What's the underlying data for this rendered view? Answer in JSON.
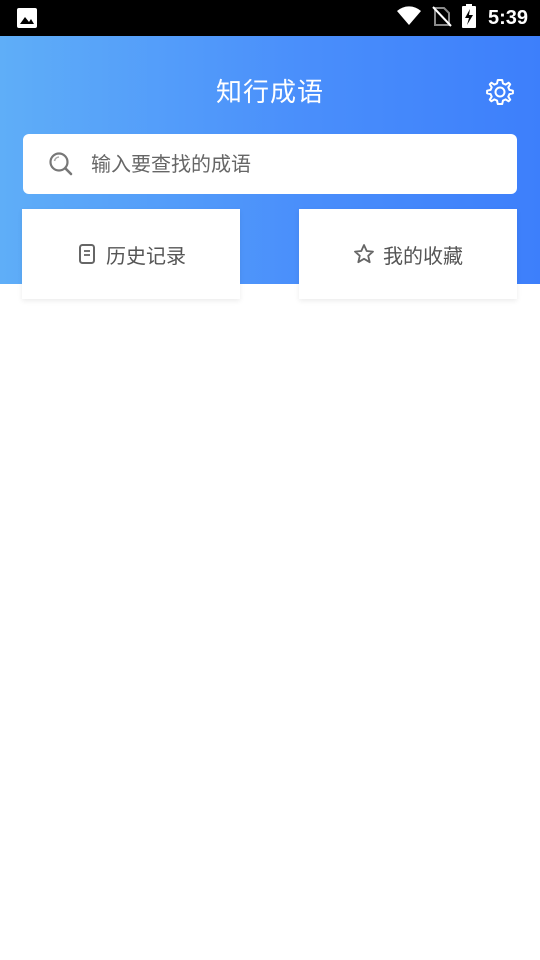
{
  "status_bar": {
    "time": "5:39",
    "icons": [
      "image-notification-icon",
      "wifi-icon",
      "no-sim-icon",
      "battery-charging-icon"
    ]
  },
  "header": {
    "title": "知行成语",
    "settings_icon": "gear-icon",
    "gradient_start": "#5faef8",
    "gradient_end": "#3d7ffb"
  },
  "search": {
    "placeholder": "输入要查找的成语",
    "value": "",
    "icon": "search-icon"
  },
  "cards": {
    "history": {
      "label": "历史记录",
      "icon": "document-icon"
    },
    "favorites": {
      "label": "我的收藏",
      "icon": "star-icon"
    }
  }
}
